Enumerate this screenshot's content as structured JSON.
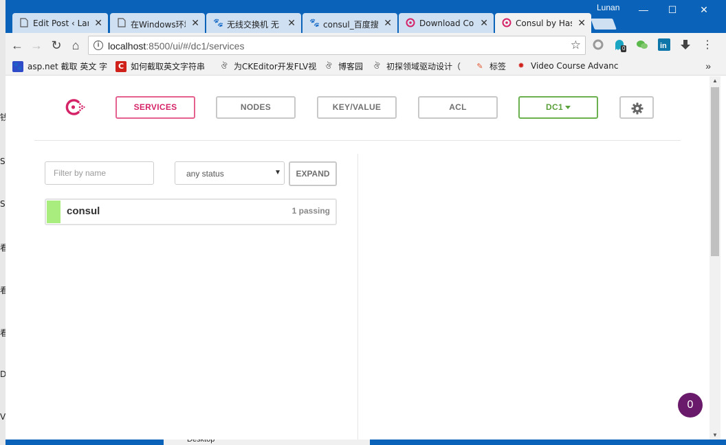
{
  "browser": {
    "user": "Lunan",
    "tabs": [
      {
        "title": "Edit Post ‹ Lam",
        "icon": "page-icon"
      },
      {
        "title": "在Windows环境",
        "icon": "page-icon"
      },
      {
        "title": "无线交换机 无",
        "icon": "baidu-paw-icon"
      },
      {
        "title": "consul_百度搜",
        "icon": "baidu-paw-icon"
      },
      {
        "title": "Download Con",
        "icon": "consul-icon"
      },
      {
        "title": "Consul by Has",
        "icon": "consul-icon"
      }
    ],
    "url_host": "localhost",
    "url_path": ":8500/ui/#/dc1/services",
    "extension_badge": "0",
    "bookmarks": [
      {
        "label": "asp.net 截取 英文 字",
        "icon": "baidu-paw-icon"
      },
      {
        "label": "如何截取英文字符串",
        "icon": "c-icon"
      },
      {
        "label": "为CKEditor开发FLV视",
        "icon": "cnblogs-icon"
      },
      {
        "label": "博客园",
        "icon": "cnblogs-icon"
      },
      {
        "label": "初探领域驱动设计（",
        "icon": "cnblogs-icon"
      },
      {
        "label": "标签",
        "icon": "tag-icon"
      },
      {
        "label": "Video Course Advanc",
        "icon": "huawei-icon"
      }
    ]
  },
  "nav": {
    "services": "SERVICES",
    "nodes": "NODES",
    "keyvalue": "KEY/VALUE",
    "acl": "ACL",
    "datacenter": "DC1"
  },
  "filters": {
    "name_placeholder": "Filter by name",
    "status_value": "any status",
    "expand_label": "EXPAND"
  },
  "services": [
    {
      "name": "consul",
      "checks": "1 passing",
      "status_color": "#a8ed7d"
    }
  ],
  "notification_count": "0",
  "desktop": {
    "taskbar_label": "Desktop"
  },
  "colors": {
    "accent": "#d52367",
    "datacenter": "#5aa13a",
    "passing": "#a8ed7d",
    "chrome_frame": "#0a63b8"
  }
}
